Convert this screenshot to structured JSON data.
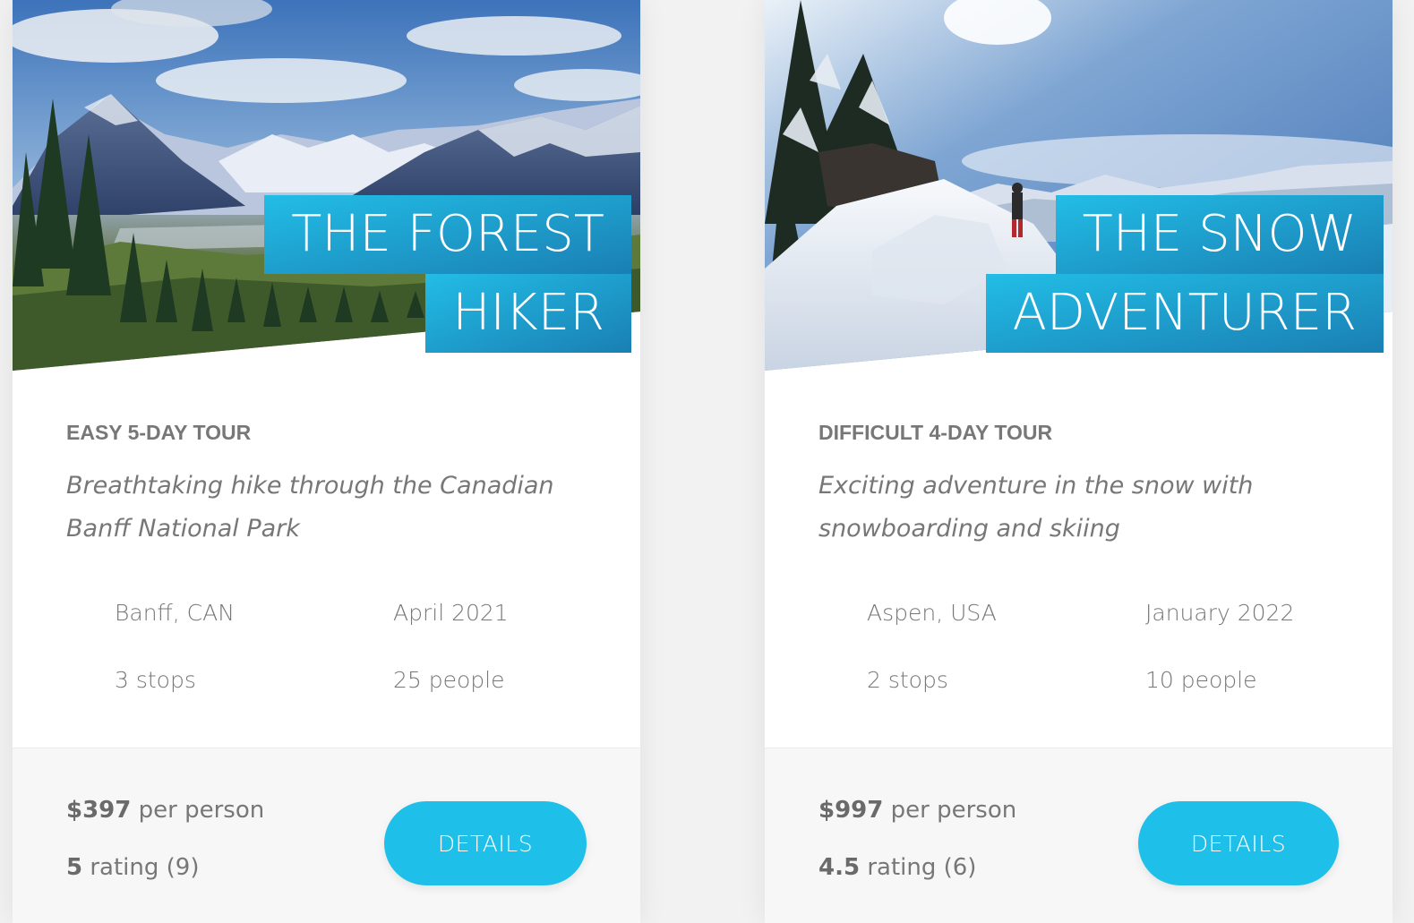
{
  "cards": [
    {
      "title_line1": "THE FOREST",
      "title_line2": "HIKER",
      "tour_type": "EASY 5-DAY TOUR",
      "description": "Breathtaking hike through the Canadian Banff National Park",
      "location": "Banff, CAN",
      "date": "April 2021",
      "stops": "3 stops",
      "people": "25 people",
      "price": "$397",
      "price_suffix": " per person",
      "rating": "5",
      "rating_suffix": " rating (9)",
      "button_label": "DETAILS"
    },
    {
      "title_line1": "THE SNOW",
      "title_line2": "ADVENTURER",
      "tour_type": "DIFFICULT 4-DAY TOUR",
      "description": "Exciting adventure in the snow with snowboarding and skiing",
      "location": "Aspen, USA",
      "date": "January 2022",
      "stops": "2 stops",
      "people": "10 people",
      "price": "$997",
      "price_suffix": " per person",
      "rating": "4.5",
      "rating_suffix": " rating (6)",
      "button_label": "DETAILS"
    }
  ],
  "colors": {
    "accent": "#1ec0ea",
    "heading_gradient_start": "#22bde6",
    "heading_gradient_end": "#1a7fb3"
  }
}
